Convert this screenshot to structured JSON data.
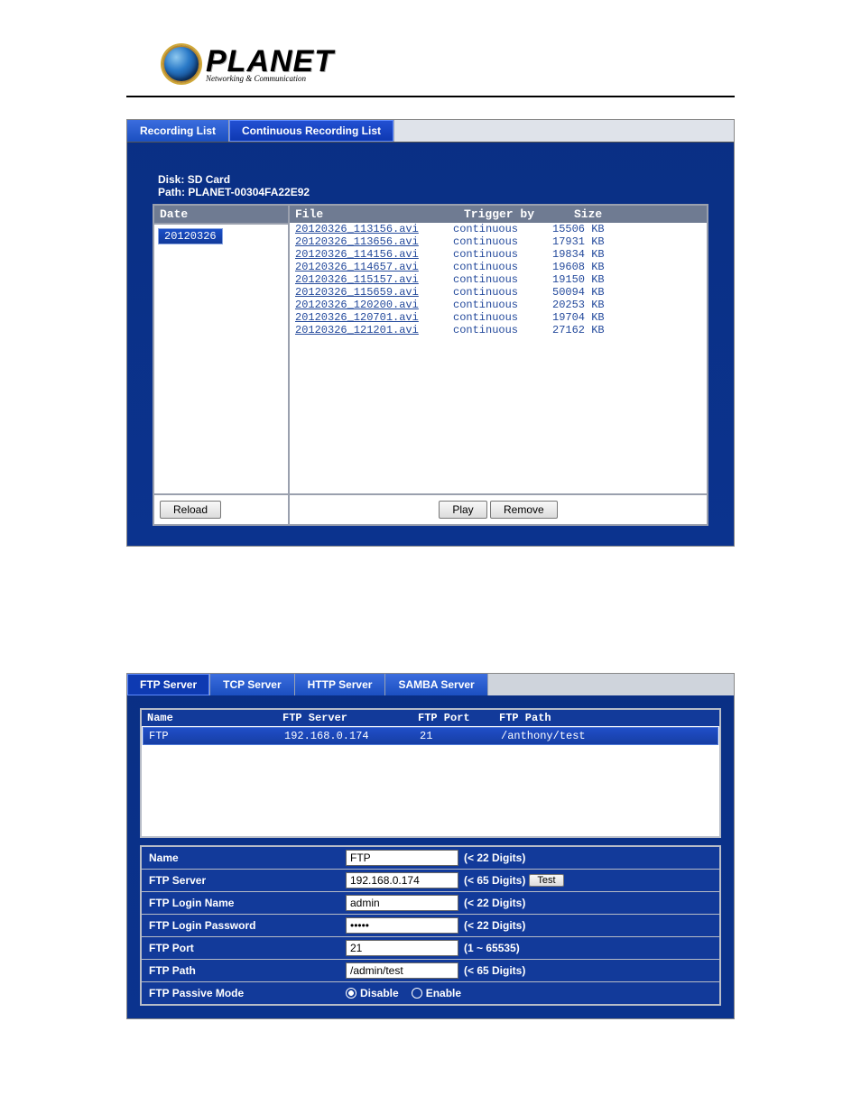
{
  "brand": {
    "name": "PLANET",
    "tagline": "Networking & Communication"
  },
  "rec": {
    "tabs": [
      "Recording List",
      "Continuous Recording List"
    ],
    "active_tab": 1,
    "disk_label": "Disk:",
    "disk": "SD Card",
    "path_label": "Path:",
    "path": "PLANET-00304FA22E92",
    "headers": {
      "date": "Date",
      "file": "File",
      "trigger": "Trigger by",
      "size": "Size"
    },
    "date": "20120326",
    "files": [
      {
        "name": "20120326_113156.avi",
        "trigger": "continuous",
        "size": "15506 KB"
      },
      {
        "name": "20120326_113656.avi",
        "trigger": "continuous",
        "size": "17931 KB"
      },
      {
        "name": "20120326_114156.avi",
        "trigger": "continuous",
        "size": "19834 KB"
      },
      {
        "name": "20120326_114657.avi",
        "trigger": "continuous",
        "size": "19608 KB"
      },
      {
        "name": "20120326_115157.avi",
        "trigger": "continuous",
        "size": "19150 KB"
      },
      {
        "name": "20120326_115659.avi",
        "trigger": "continuous",
        "size": "50094 KB"
      },
      {
        "name": "20120326_120200.avi",
        "trigger": "continuous",
        "size": "20253 KB"
      },
      {
        "name": "20120326_120701.avi",
        "trigger": "continuous",
        "size": "19704 KB"
      },
      {
        "name": "20120326_121201.avi",
        "trigger": "continuous",
        "size": "27162 KB"
      }
    ],
    "buttons": {
      "reload": "Reload",
      "play": "Play",
      "remove": "Remove"
    }
  },
  "srv": {
    "tabs": [
      "FTP Server",
      "TCP Server",
      "HTTP Server",
      "SAMBA Server"
    ],
    "active_tab": 0,
    "list_headers": {
      "name": "Name",
      "server": "FTP Server",
      "port": "FTP Port",
      "path": "FTP Path"
    },
    "entry": {
      "name": "FTP",
      "server": "192.168.0.174",
      "port": "21",
      "path": "/anthony/test"
    },
    "fields": {
      "name": {
        "label": "Name",
        "value": "FTP",
        "hint": "(< 22 Digits)"
      },
      "server": {
        "label": "FTP Server",
        "value": "192.168.0.174",
        "hint": "(< 65 Digits)",
        "test": "Test"
      },
      "login": {
        "label": "FTP Login Name",
        "value": "admin",
        "hint": "(< 22 Digits)"
      },
      "pass": {
        "label": "FTP Login Password",
        "value": "•••••",
        "hint": "(< 22 Digits)"
      },
      "port": {
        "label": "FTP Port",
        "value": "21",
        "hint": "(1 ~ 65535)"
      },
      "path": {
        "label": "FTP Path",
        "value": "/admin/test",
        "hint": "(< 65 Digits)"
      },
      "passive": {
        "label": "FTP Passive Mode",
        "disable": "Disable",
        "enable": "Enable"
      }
    }
  }
}
